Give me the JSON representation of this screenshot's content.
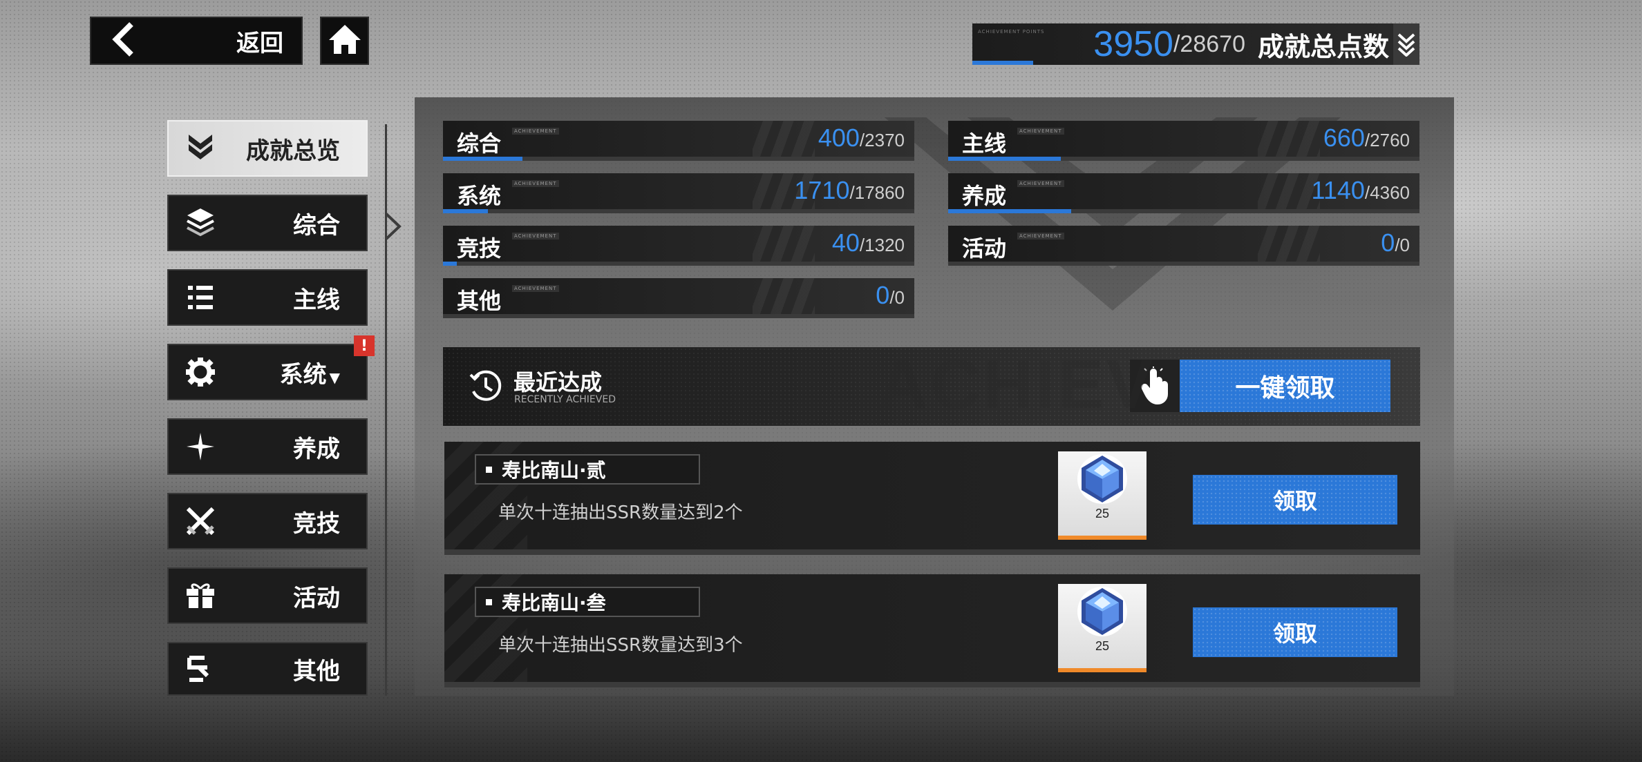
{
  "header": {
    "back_label": "返回",
    "total_current": "3950",
    "total_max": "/28670",
    "total_label": "成就总点数",
    "total_tag": "ACHIEVEMENT POINTS"
  },
  "sidebar": {
    "items": [
      {
        "label": "成就总览",
        "icon": "chevron-stack-icon",
        "active": true
      },
      {
        "label": "综合",
        "icon": "layers-icon"
      },
      {
        "label": "主线",
        "icon": "list-icon"
      },
      {
        "label": "系统",
        "icon": "gear-icon",
        "alert": "!",
        "has_dropdown": true
      },
      {
        "label": "养成",
        "icon": "sparkle-icon"
      },
      {
        "label": "竞技",
        "icon": "crossed-swords-icon"
      },
      {
        "label": "活动",
        "icon": "gift-icon"
      },
      {
        "label": "其他",
        "icon": "misc-icon"
      }
    ]
  },
  "categories": [
    {
      "name": "综合",
      "tag": "ACHIEVEMENT",
      "current": "400",
      "max": "/2370",
      "progress": 0.169
    },
    {
      "name": "主线",
      "tag": "ACHIEVEMENT",
      "current": "660",
      "max": "/2760",
      "progress": 0.239
    },
    {
      "name": "系统",
      "tag": "ACHIEVEMENT",
      "current": "1710",
      "max": "/17860",
      "progress": 0.096
    },
    {
      "name": "养成",
      "tag": "ACHIEVEMENT",
      "current": "1140",
      "max": "/4360",
      "progress": 0.261
    },
    {
      "name": "竞技",
      "tag": "ACHIEVEMENT",
      "current": "40",
      "max": "/1320",
      "progress": 0.03
    },
    {
      "name": "活动",
      "tag": "ACHIEVEMENT",
      "current": "0",
      "max": "/0",
      "progress": 0
    },
    {
      "name": "其他",
      "tag": "ACHIEVEMENT",
      "current": "0",
      "max": "/0",
      "progress": 0
    }
  ],
  "recent": {
    "title": "最近达成",
    "subtitle": "RECENTLY ACHIEVED",
    "claim_all_label": "一键领取",
    "watermark": "ACHIEV"
  },
  "achievements": [
    {
      "title": "寿比南山·贰",
      "desc": "单次十连抽出SSR数量达到2个",
      "reward_icon": "crystal-icon",
      "reward_qty": "25",
      "claim_label": "领取"
    },
    {
      "title": "寿比南山·叁",
      "desc": "单次十连抽出SSR数量达到3个",
      "reward_icon": "crystal-icon",
      "reward_qty": "25",
      "claim_label": "领取"
    }
  ],
  "colors": {
    "accent": "#2b78d8",
    "score_blue": "#3a90f0",
    "alert_red": "#d8342c",
    "reward_orange": "#f08a2a"
  }
}
